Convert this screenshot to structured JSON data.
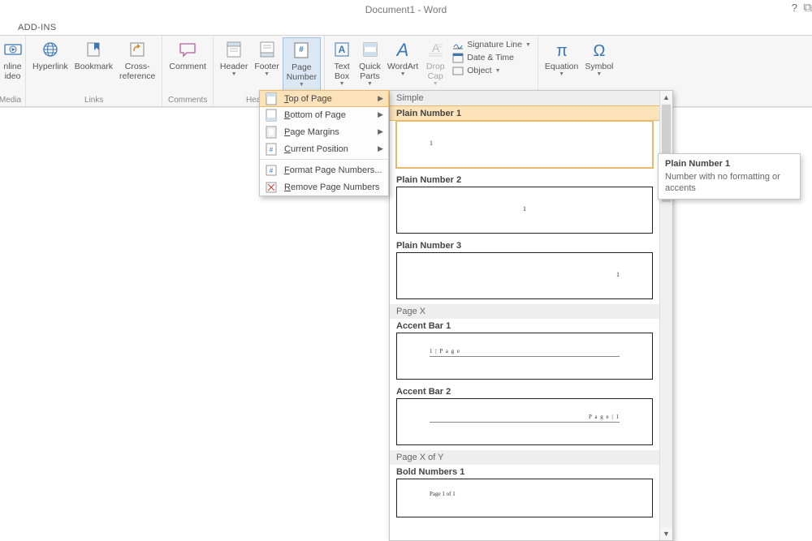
{
  "title": "Document1 - Word",
  "tabs": {
    "addins": "ADD-INS"
  },
  "ribbon": {
    "media": {
      "online_video": "nline\nideo",
      "group": "Media"
    },
    "links": {
      "hyperlink": "Hyperlink",
      "bookmark": "Bookmark",
      "cross_reference": "Cross-\nreference",
      "group": "Links"
    },
    "comments": {
      "comment": "Comment",
      "group": "Comments"
    },
    "headerfooter": {
      "header": "Header",
      "footer": "Footer",
      "page_number": "Page\nNumber",
      "group": "Header & Footer"
    },
    "text": {
      "text_box": "Text\nBox",
      "quick_parts": "Quick\nParts",
      "wordart": "WordArt",
      "drop_cap": "Drop\nCap",
      "signature": "Signature Line",
      "datetime": "Date & Time",
      "object": "Object"
    },
    "symbols": {
      "equation": "Equation",
      "symbol": "Symbol"
    }
  },
  "menu": {
    "top_of_page": "Top of Page",
    "bottom_of_page": "Bottom of Page",
    "page_margins": "Page Margins",
    "current_position": "Current Position",
    "format": "Format Page Numbers...",
    "remove": "Remove Page Numbers"
  },
  "gallery": {
    "cat_simple": "Simple",
    "plain1": "Plain Number 1",
    "plain2": "Plain Number 2",
    "plain3": "Plain Number 3",
    "cat_pagex": "Page X",
    "accent1": "Accent Bar 1",
    "accent1_text": "1 | P a g e",
    "accent2": "Accent Bar 2",
    "accent2_text": "P a g e  | 1",
    "cat_pagexy": "Page X of Y",
    "bold1": "Bold Numbers 1",
    "bold1_text": "Page 1 of 1"
  },
  "tooltip": {
    "title": "Plain Number 1",
    "body": "Number with no formatting or accents"
  }
}
